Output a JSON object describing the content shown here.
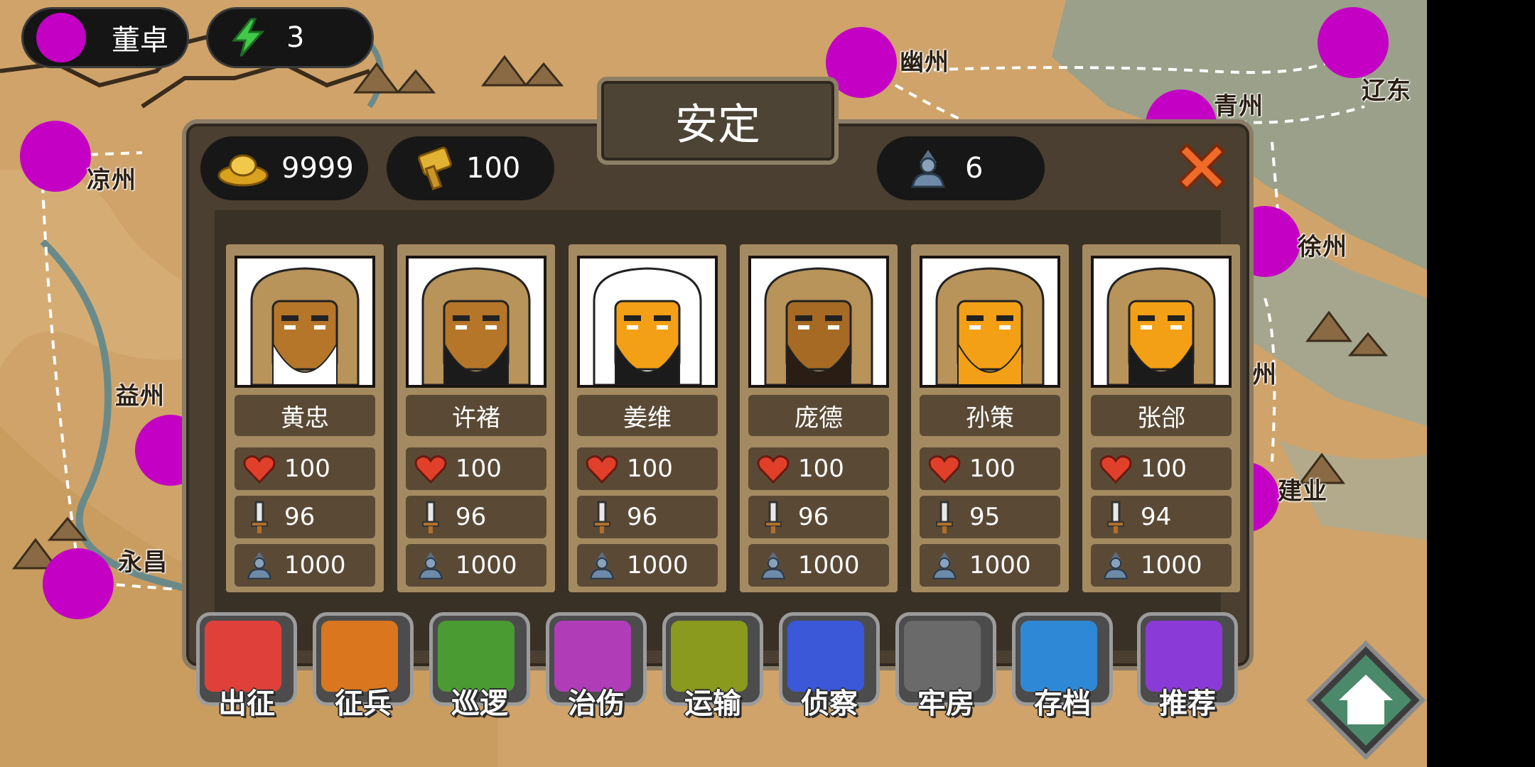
{
  "player": {
    "faction": "董卓",
    "faction_color": "#c300c3",
    "energy": "3"
  },
  "map": {
    "cities": [
      {
        "name": "幽州"
      },
      {
        "name": "辽东"
      },
      {
        "name": "青州"
      },
      {
        "name": "凉州"
      },
      {
        "name": "徐州"
      },
      {
        "name": "益州"
      },
      {
        "name": "州"
      },
      {
        "name": "建业"
      },
      {
        "name": "永昌"
      }
    ]
  },
  "panel": {
    "title": "安定",
    "gold": "9999",
    "food": "100",
    "troops": "6",
    "generals": [
      {
        "name": "黄忠",
        "hp": "100",
        "attack": "96",
        "soldiers": "1000"
      },
      {
        "name": "许褚",
        "hp": "100",
        "attack": "96",
        "soldiers": "1000"
      },
      {
        "name": "姜维",
        "hp": "100",
        "attack": "96",
        "soldiers": "1000"
      },
      {
        "name": "庞德",
        "hp": "100",
        "attack": "96",
        "soldiers": "1000"
      },
      {
        "name": "孙策",
        "hp": "100",
        "attack": "95",
        "soldiers": "1000"
      },
      {
        "name": "张郃",
        "hp": "100",
        "attack": "94",
        "soldiers": "1000"
      }
    ]
  },
  "actions": [
    {
      "label": "出征",
      "icon": "spear-icon",
      "color": "#e0403a"
    },
    {
      "label": "征兵",
      "icon": "recruit-icon",
      "color": "#d9761e"
    },
    {
      "label": "巡逻",
      "icon": "patrol-icon",
      "color": "#4a9b32"
    },
    {
      "label": "治伤",
      "icon": "meat-icon",
      "color": "#b03cb8"
    },
    {
      "label": "运输",
      "icon": "cart-icon",
      "color": "#8a9a1e"
    },
    {
      "label": "侦察",
      "icon": "radar-icon",
      "color": "#3a58d8"
    },
    {
      "label": "牢房",
      "icon": "jail-icon",
      "color": "#6a6a6a"
    },
    {
      "label": "存档",
      "icon": "book-icon",
      "color": "#2e88d6"
    },
    {
      "label": "推荐",
      "icon": "more-icon",
      "color": "#8a3ad6"
    }
  ]
}
